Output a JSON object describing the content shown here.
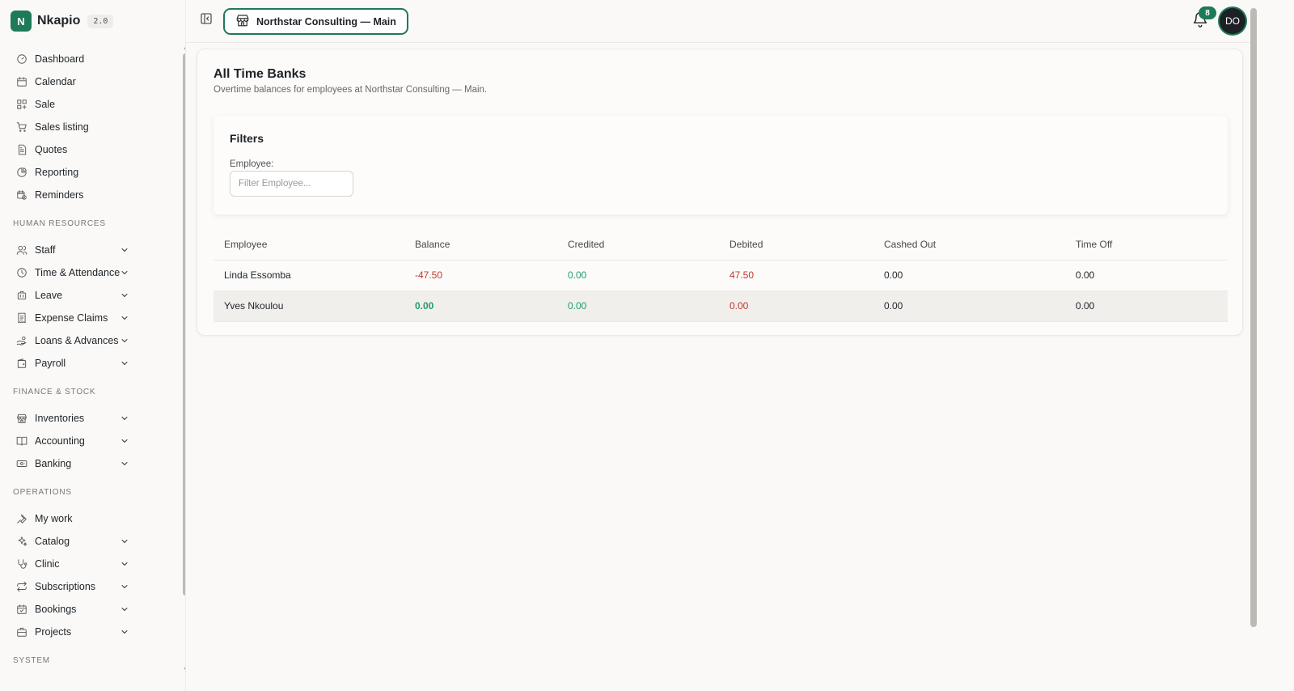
{
  "brand": {
    "initial": "N",
    "name": "Nkapio",
    "version": "2.0"
  },
  "nav_main": [
    {
      "label": "Dashboard",
      "icon": "gauge-icon"
    },
    {
      "label": "Calendar",
      "icon": "calendar-icon"
    },
    {
      "label": "Sale",
      "icon": "grid-plus-icon"
    },
    {
      "label": "Sales listing",
      "icon": "cart-icon"
    },
    {
      "label": "Quotes",
      "icon": "document-icon"
    },
    {
      "label": "Reporting",
      "icon": "pie-chart-icon"
    },
    {
      "label": "Reminders",
      "icon": "calendar-clock-icon"
    }
  ],
  "sections": {
    "hr": "HUMAN RESOURCES",
    "finance": "FINANCE & STOCK",
    "operations": "OPERATIONS",
    "system": "SYSTEM"
  },
  "nav_hr": [
    {
      "label": "Staff",
      "icon": "users-icon"
    },
    {
      "label": "Time & Attendance",
      "icon": "clock-icon"
    },
    {
      "label": "Leave",
      "icon": "suitcase-icon"
    },
    {
      "label": "Expense Claims",
      "icon": "receipt-icon"
    },
    {
      "label": "Loans & Advances",
      "icon": "hand-coins-icon"
    },
    {
      "label": "Payroll",
      "icon": "wallet-icon"
    }
  ],
  "nav_finance": [
    {
      "label": "Inventories",
      "icon": "store-icon"
    },
    {
      "label": "Accounting",
      "icon": "book-icon"
    },
    {
      "label": "Banking",
      "icon": "banknote-icon"
    }
  ],
  "nav_ops": [
    {
      "label": "My work",
      "icon": "wrench-icon"
    },
    {
      "label": "Catalog",
      "icon": "sparkles-icon"
    },
    {
      "label": "Clinic",
      "icon": "stethoscope-icon"
    },
    {
      "label": "Subscriptions",
      "icon": "repeat-icon"
    },
    {
      "label": "Bookings",
      "icon": "calendar-check-icon"
    },
    {
      "label": "Projects",
      "icon": "briefcase-icon"
    }
  ],
  "topbar": {
    "branch": "Northstar Consulting — Main",
    "notifications": "8",
    "avatar": "DO"
  },
  "page": {
    "title": "All Time Banks",
    "subtitle": "Overtime balances for employees at Northstar Consulting — Main."
  },
  "filters": {
    "title": "Filters",
    "employee_label": "Employee:",
    "employee_placeholder": "Filter Employee..."
  },
  "table": {
    "headers": [
      "Employee",
      "Balance",
      "Credited",
      "Debited",
      "Cashed Out",
      "Time Off"
    ],
    "rows": [
      {
        "employee": "Linda Essomba",
        "balance": "-47.50",
        "credited": "0.00",
        "debited": "47.50",
        "cashed_out": "0.00",
        "time_off": "0.00"
      },
      {
        "employee": "Yves Nkoulou",
        "balance": "0.00",
        "credited": "0.00",
        "debited": "0.00",
        "cashed_out": "0.00",
        "time_off": "0.00"
      }
    ]
  },
  "colors": {
    "accent": "#1f7a5a",
    "negative": "#c0392b",
    "positive": "#1f9d6b"
  }
}
